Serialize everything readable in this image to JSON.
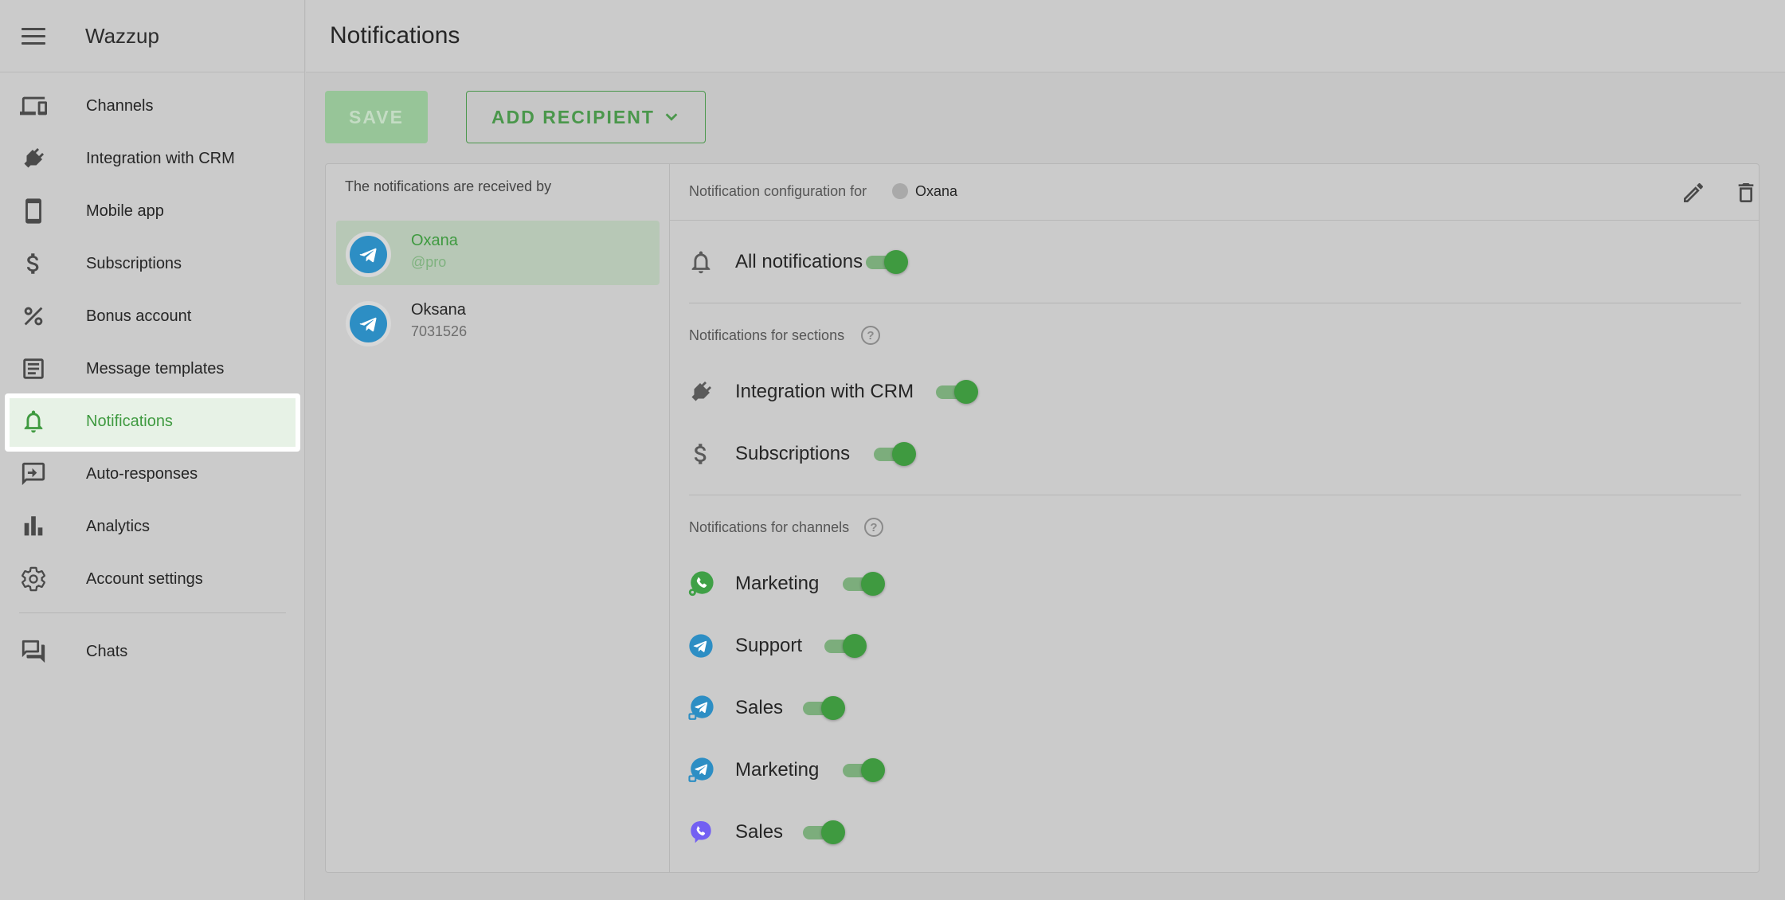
{
  "app": {
    "brand": "Wazzup"
  },
  "page": {
    "title": "Notifications"
  },
  "sidebar": {
    "items": [
      {
        "label": "Channels",
        "icon": "devices-icon"
      },
      {
        "label": "Integration with CRM",
        "icon": "plug-icon"
      },
      {
        "label": "Mobile app",
        "icon": "phone-icon"
      },
      {
        "label": "Subscriptions",
        "icon": "dollar-icon"
      },
      {
        "label": "Bonus account",
        "icon": "percent-icon"
      },
      {
        "label": "Message templates",
        "icon": "template-icon"
      },
      {
        "label": "Notifications",
        "icon": "bell-icon",
        "active": true
      },
      {
        "label": "Auto-responses",
        "icon": "auto-response-icon"
      },
      {
        "label": "Analytics",
        "icon": "bar-chart-icon"
      },
      {
        "label": "Account settings",
        "icon": "gear-icon"
      },
      {
        "label": "Chats",
        "icon": "chats-icon"
      }
    ]
  },
  "toolbar": {
    "save_label": "SAVE",
    "add_recipient_label": "ADD RECIPIENT"
  },
  "recipients": {
    "title": "The notifications are received by",
    "items": [
      {
        "name": "Oxana",
        "sub": "@pro",
        "selected": true,
        "icon": "telegram-icon"
      },
      {
        "name": "Oksana",
        "sub": "7031526",
        "selected": false,
        "icon": "telegram-icon"
      }
    ]
  },
  "config": {
    "label": "Notification configuration for",
    "user": "Oxana",
    "all_notifications": {
      "label": "All notifications",
      "on": true
    },
    "sections_title": "Notifications for sections",
    "sections": [
      {
        "label": "Integration with CRM",
        "icon": "plug-icon",
        "on": true
      },
      {
        "label": "Subscriptions",
        "icon": "dollar-icon",
        "on": true
      }
    ],
    "channels_title": "Notifications for channels",
    "channels": [
      {
        "label": "Marketing",
        "icon": "whatsapp-business-icon",
        "on": true
      },
      {
        "label": "Support",
        "icon": "telegram-icon",
        "on": true
      },
      {
        "label": "Sales",
        "icon": "telegram-personal-icon",
        "on": true
      },
      {
        "label": "Marketing",
        "icon": "telegram-personal-icon",
        "on": true
      },
      {
        "label": "Sales",
        "icon": "viber-icon",
        "on": true
      }
    ]
  },
  "colors": {
    "accent": "#3f9a40",
    "telegram": "#2d8ec4",
    "whatsapp": "#3fa046",
    "viber": "#7360f2"
  }
}
